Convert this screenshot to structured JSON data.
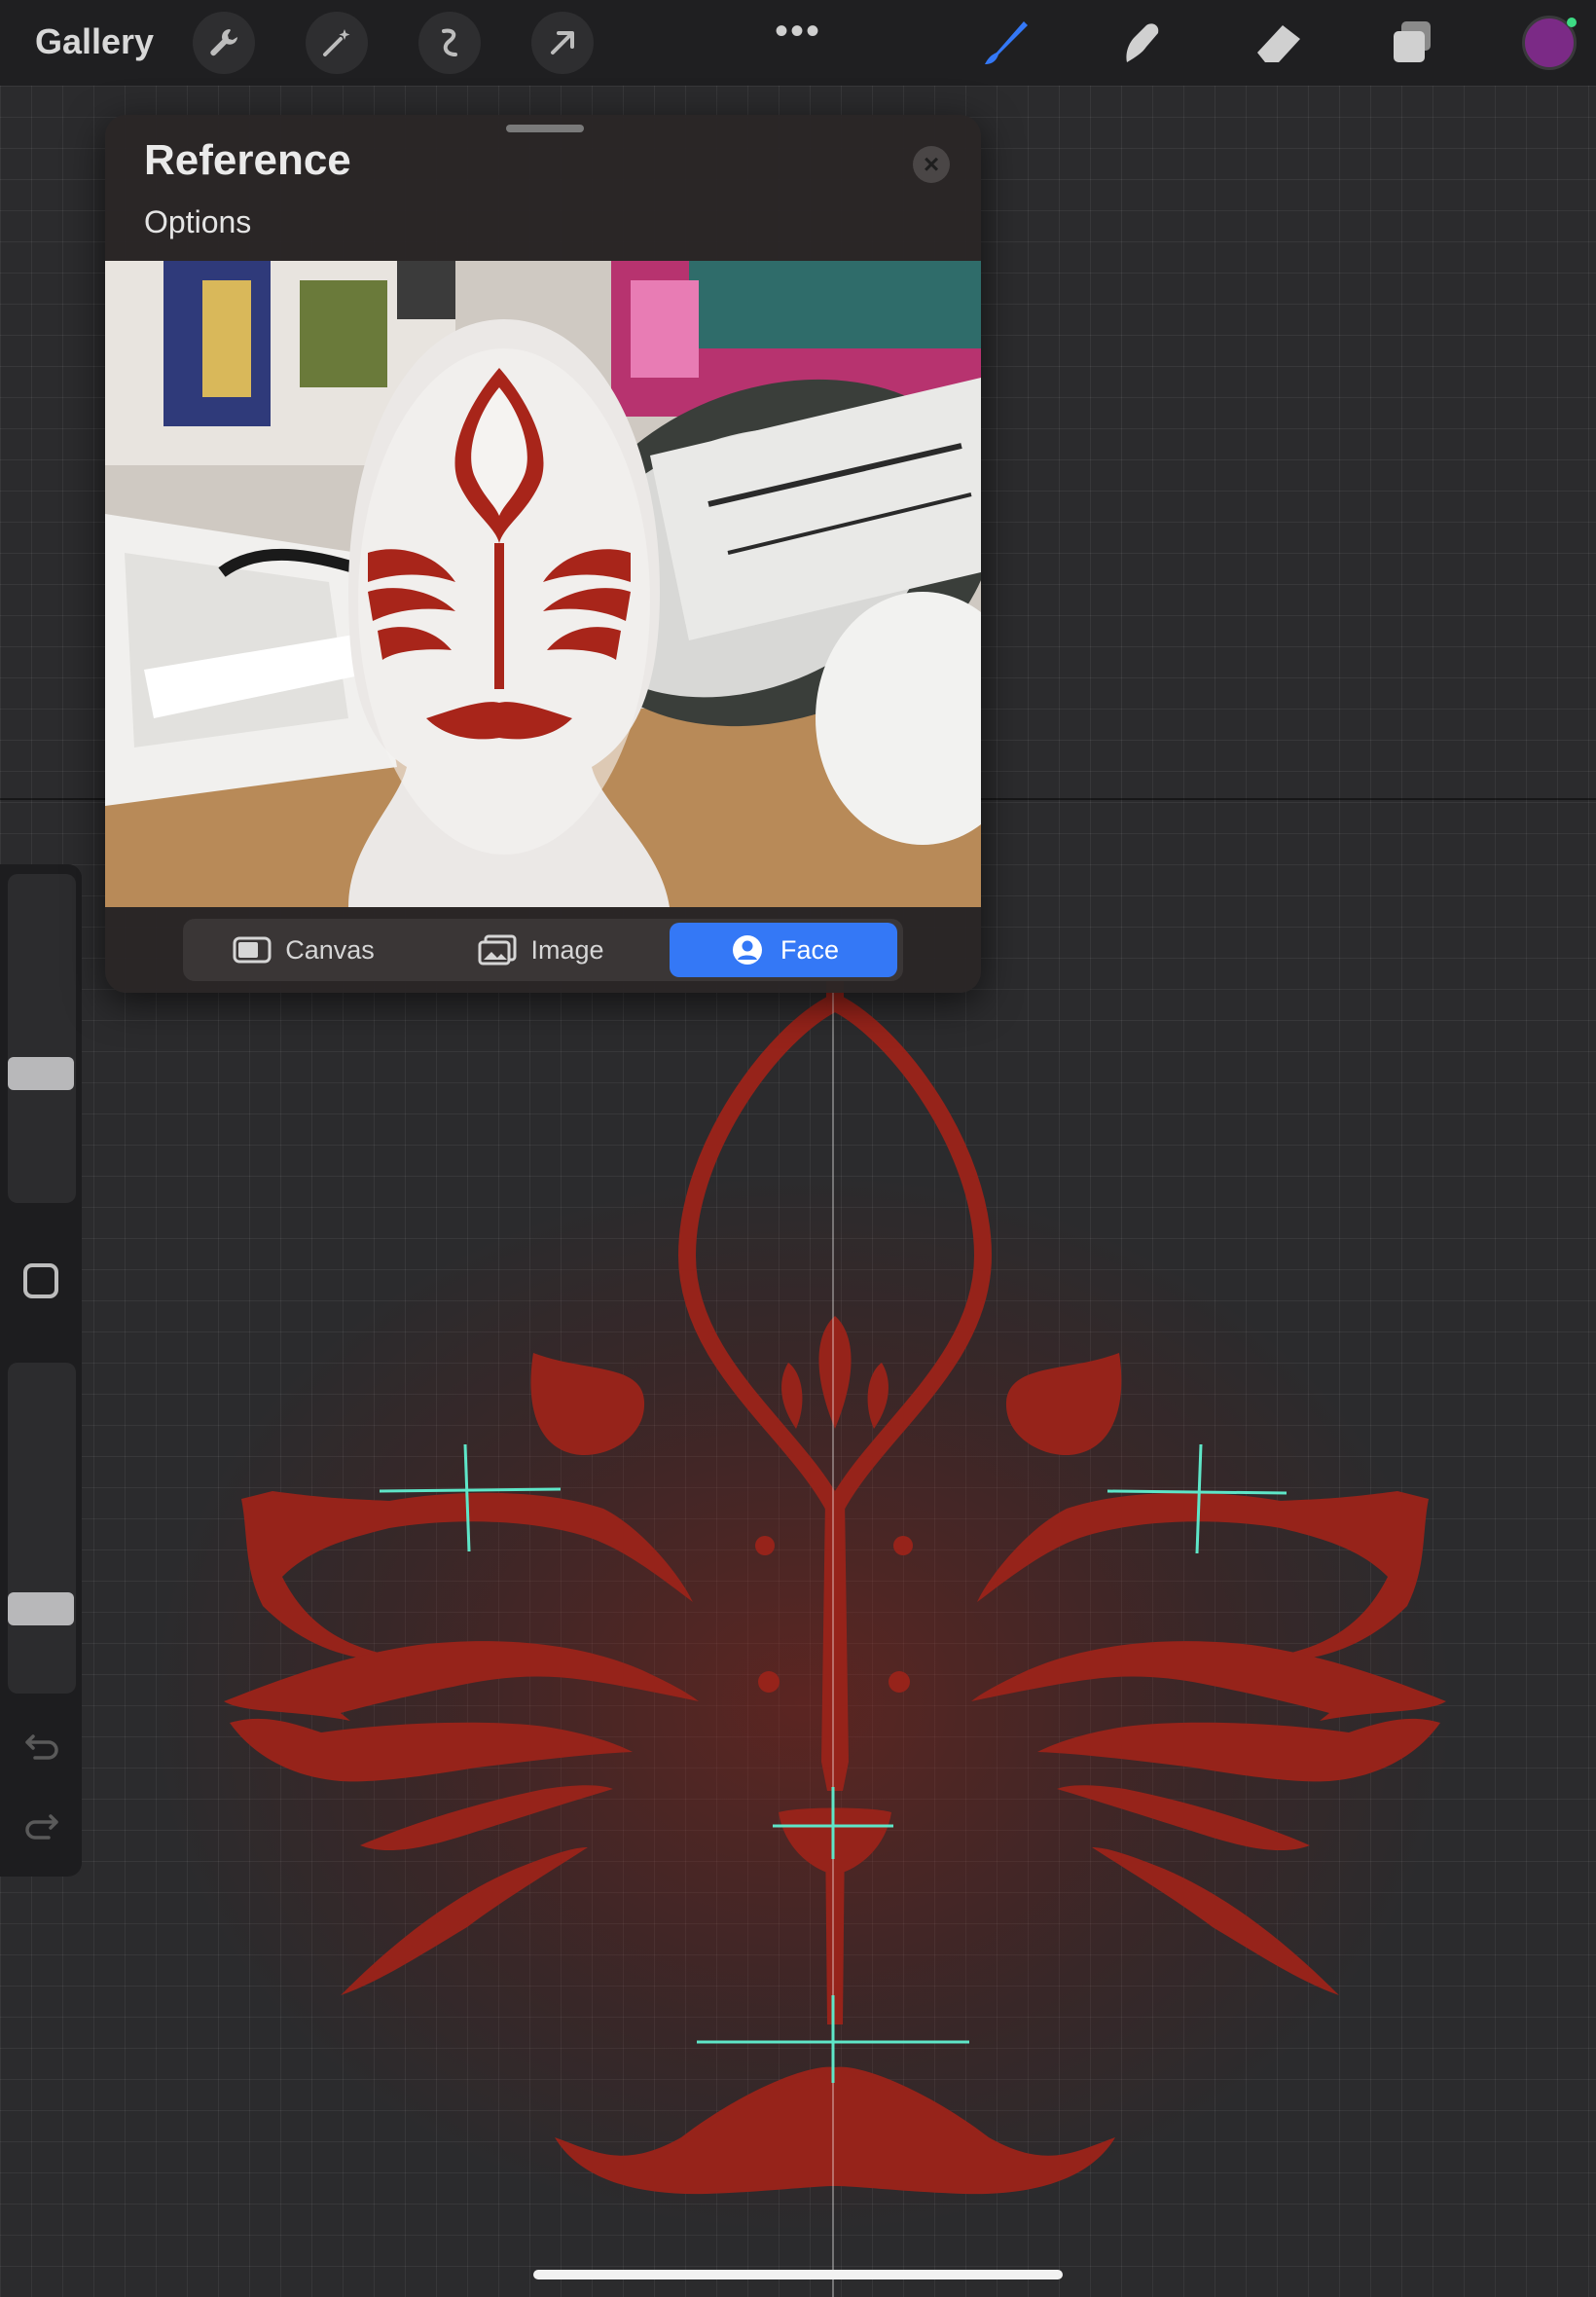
{
  "topbar": {
    "gallery_label": "Gallery",
    "left_tools": [
      "wrench-icon",
      "magic-wand-icon",
      "selection-icon",
      "transform-arrow-icon"
    ],
    "more_label": "•••",
    "right_tools": [
      "brush-icon",
      "smudge-icon",
      "eraser-icon",
      "layers-icon"
    ],
    "current_color": "#7b2a86",
    "active_tool_color": "#3478f6"
  },
  "reference_panel": {
    "title": "Reference",
    "options_label": "Options",
    "close_label": "×",
    "tabs": [
      {
        "label": "Canvas",
        "icon": "canvas-icon",
        "active": false
      },
      {
        "label": "Image",
        "icon": "image-icon",
        "active": false
      },
      {
        "label": "Face",
        "icon": "face-icon",
        "active": true
      }
    ]
  },
  "sidebar": {
    "brush_size_level": 0.55,
    "opacity_level": 0.7,
    "undo_icon": "undo-icon",
    "redo_icon": "redo-icon"
  },
  "canvas": {
    "paint_color": "#96231a",
    "guide_color": "#5ee6c8"
  }
}
